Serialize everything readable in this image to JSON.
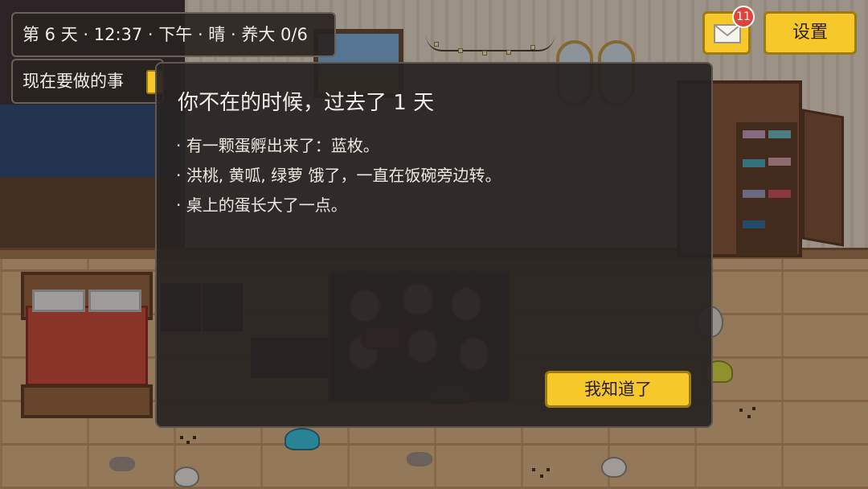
{
  "hud": {
    "status_text": "第 6 天 · 12:37 · 下午 · 晴 · 养大 0/6",
    "todo_label": "现在要做的事",
    "todo_icon": "checklist-icon"
  },
  "mail": {
    "icon": "envelope-icon",
    "unread_count": "11"
  },
  "settings": {
    "label": "设置"
  },
  "dialog": {
    "title": "你不在的时候，过去了 1 天",
    "lines": [
      "· 有一颗蛋孵出来了：蓝枚。",
      "· 洪桃, 黄呱, 绿萝 饿了，一直在饭碗旁边转。",
      "· 桌上的蛋长大了一点。"
    ],
    "confirm_label": "我知道了"
  },
  "colors": {
    "button_yellow": "#f7c82a",
    "panel_dark": "#282220",
    "badge_red": "#e0433a"
  }
}
